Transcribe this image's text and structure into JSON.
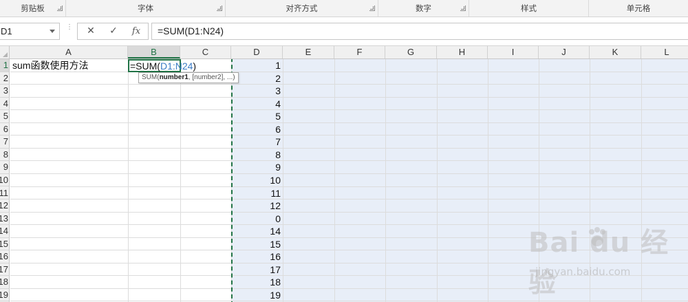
{
  "ribbon": {
    "groups": [
      {
        "label": "剪贴板"
      },
      {
        "label": "字体"
      },
      {
        "label": "对齐方式"
      },
      {
        "label": "数字"
      },
      {
        "label": "样式"
      },
      {
        "label": "单元格"
      }
    ]
  },
  "formula_bar": {
    "name_box": "D1",
    "cancel_icon": "✕",
    "enter_icon": "✓",
    "fx_label": "fx",
    "formula": "=SUM(D1:N24)"
  },
  "columns": [
    "A",
    "B",
    "C",
    "D",
    "E",
    "F",
    "G",
    "H",
    "I",
    "J",
    "K",
    "L"
  ],
  "selected_column": "B",
  "rows": [
    "1",
    "2",
    "3",
    "4",
    "5",
    "6",
    "7",
    "8",
    "9",
    "10",
    "11",
    "12",
    "13",
    "14",
    "15",
    "16",
    "17",
    "18",
    "19"
  ],
  "cells": {
    "A1": "sum函数使用方法",
    "B1_prefix": "=SUM(",
    "B1_ref": "D1:N24",
    "B1_suffix": ")",
    "D_values": [
      "1",
      "2",
      "3",
      "4",
      "5",
      "6",
      "7",
      "8",
      "9",
      "10",
      "11",
      "12",
      "0",
      "14",
      "15",
      "16",
      "17",
      "18",
      "19"
    ]
  },
  "tooltip": {
    "fn": "SUM(",
    "arg1": "number1",
    "rest": ", [number2], ...)"
  },
  "watermark": {
    "logo": "Bai  du 经验",
    "url": "jingyan.baidu.com"
  },
  "colors": {
    "accent": "#217346",
    "range_fill": "#e8eef8",
    "ref_blue": "#3b7cc5"
  }
}
